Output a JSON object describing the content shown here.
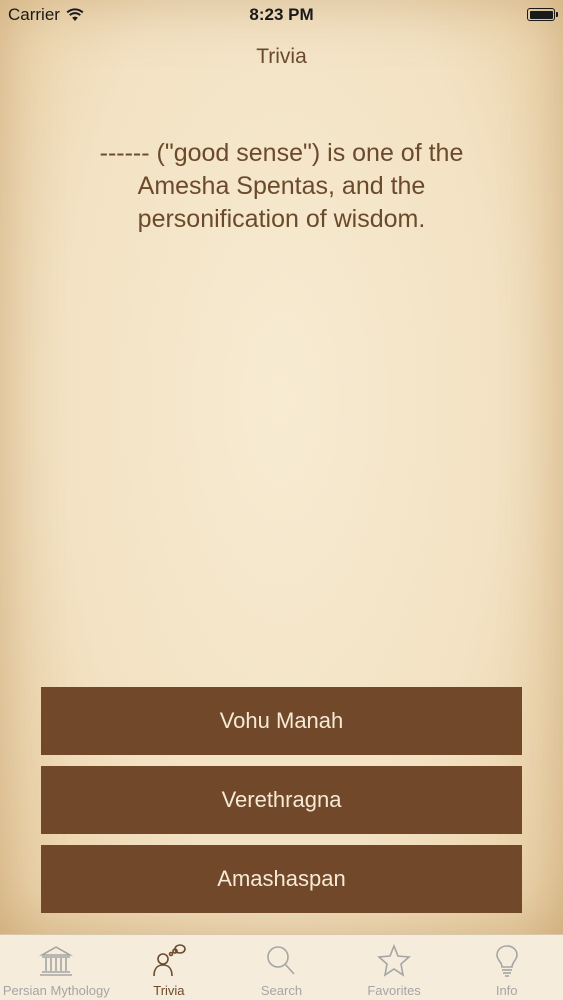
{
  "status_bar": {
    "carrier": "Carrier",
    "time": "8:23 PM"
  },
  "nav": {
    "title": "Trivia"
  },
  "question": "------ (\"good sense\") is one of the Amesha Spentas, and the personification of wisdom.",
  "answers": [
    "Vohu Manah",
    "Verethragna",
    "Amashaspan"
  ],
  "tabs": [
    {
      "label": "Persian Mythology",
      "icon": "temple-icon"
    },
    {
      "label": "Trivia",
      "icon": "thinking-person-icon",
      "active": true
    },
    {
      "label": "Search",
      "icon": "search-icon"
    },
    {
      "label": "Favorites",
      "icon": "star-icon"
    },
    {
      "label": "Info",
      "icon": "lightbulb-icon"
    }
  ],
  "colors": {
    "accent": "#6b4a2c",
    "button": "#71492a",
    "button_text": "#f6ead6",
    "tab_inactive": "#a5a5a5"
  }
}
